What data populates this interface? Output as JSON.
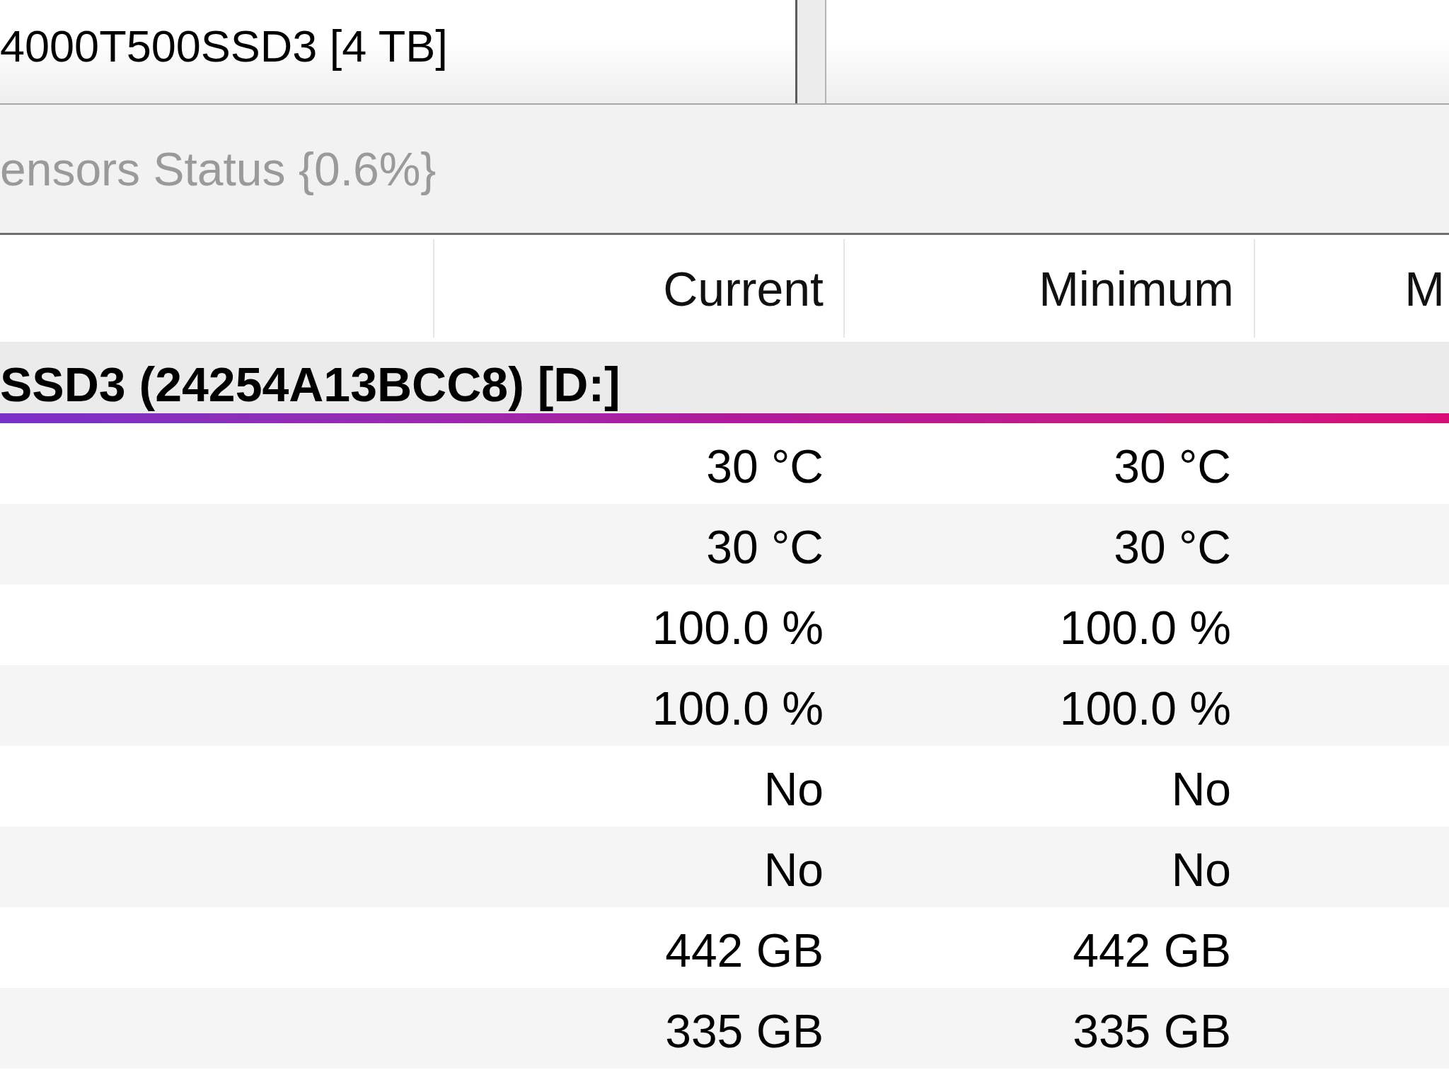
{
  "device_panel": {
    "item": "4000T500SSD3 [4 TB]"
  },
  "status_bar": {
    "text": "ensors Status {0.6%}"
  },
  "sensor_table": {
    "columns": [
      "Current",
      "Minimum",
      "M"
    ],
    "group": {
      "title": "SSD3 (24254A13BCC8) [D:]"
    },
    "rows": [
      {
        "current": "30 °C",
        "minimum": "30 °C"
      },
      {
        "current": "30 °C",
        "minimum": "30 °C"
      },
      {
        "current": "100.0 %",
        "minimum": "100.0 %"
      },
      {
        "current": "100.0 %",
        "minimum": "100.0 %"
      },
      {
        "current": "No",
        "minimum": "No"
      },
      {
        "current": "No",
        "minimum": "No"
      },
      {
        "current": "442 GB",
        "minimum": "442 GB"
      },
      {
        "current": "335 GB",
        "minimum": "335 GB"
      }
    ]
  }
}
